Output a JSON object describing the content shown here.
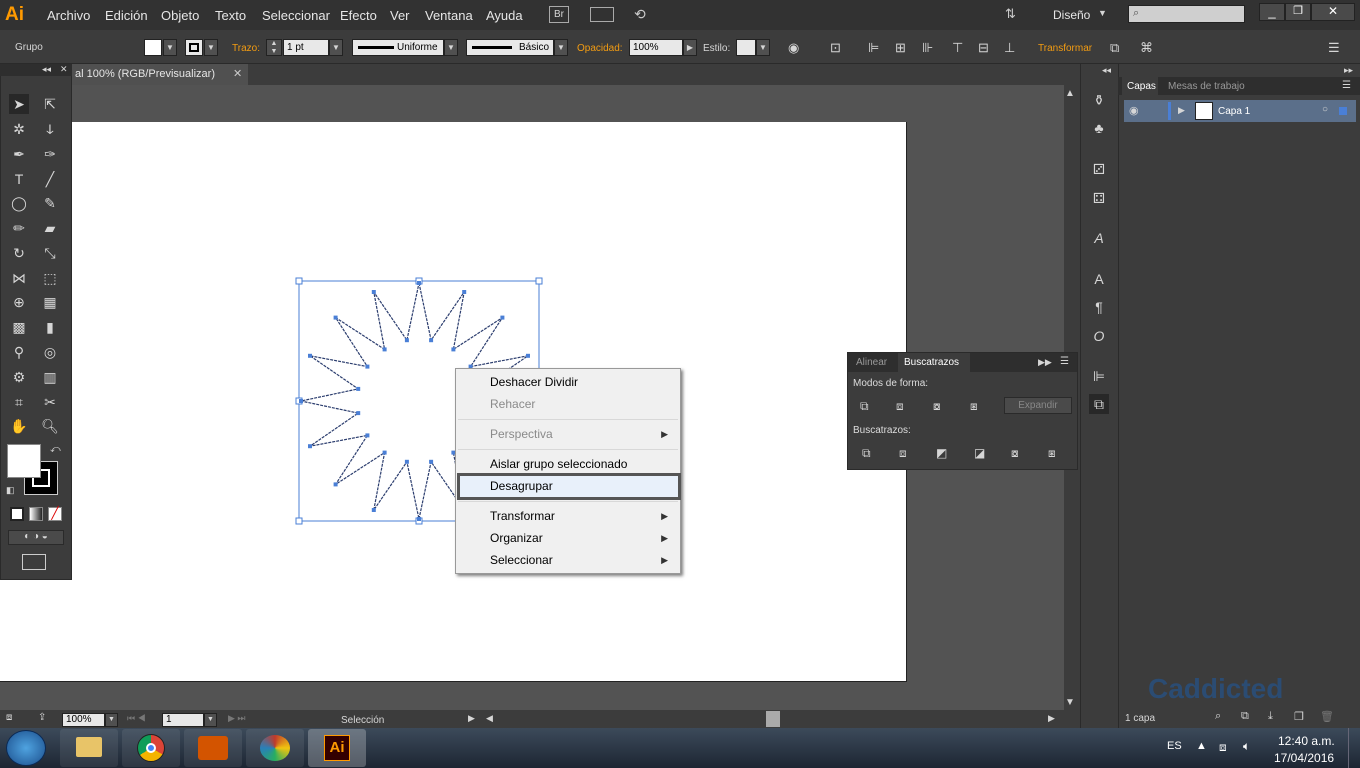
{
  "app": {
    "logo": "Ai"
  },
  "menu": [
    "Archivo",
    "Edición",
    "Objeto",
    "Texto",
    "Seleccionar",
    "Efecto",
    "Ver",
    "Ventana",
    "Ayuda"
  ],
  "br_button": "Br",
  "workspace": "Diseño",
  "control": {
    "group_label": "Grupo",
    "stroke_label": "Trazo:",
    "stroke_value": "1 pt",
    "stroke_profile": "Uniforme",
    "brush": "Básico",
    "opacity_label": "Opacidad:",
    "opacity_value": "100%",
    "style_label": "Estilo:",
    "transform_label": "Transformar"
  },
  "doc_tab": "al 100% (RGB/Previsualizar)",
  "context_menu": {
    "items": [
      "Deshacer Dividir",
      "Rehacer",
      "Perspectiva",
      "Aislar grupo seleccionado",
      "Desagrupar",
      "Transformar",
      "Organizar",
      "Seleccionar"
    ]
  },
  "pathfinder": {
    "tabs": [
      "Alinear",
      "Buscatrazos"
    ],
    "shape_modes": "Modos de forma:",
    "expand": "Expandir",
    "pathfinders": "Buscatrazos:"
  },
  "layers": {
    "tabs": [
      "Capas",
      "Mesas de trabajo"
    ],
    "layer_name": "Capa 1",
    "count": "1 capa"
  },
  "status": {
    "zoom": "100%",
    "page": "1",
    "tool": "Selección"
  },
  "taskbar": {
    "lang": "ES",
    "time": "12:40 a.m.",
    "date": "17/04/2016"
  },
  "watermark": "Caddicted"
}
